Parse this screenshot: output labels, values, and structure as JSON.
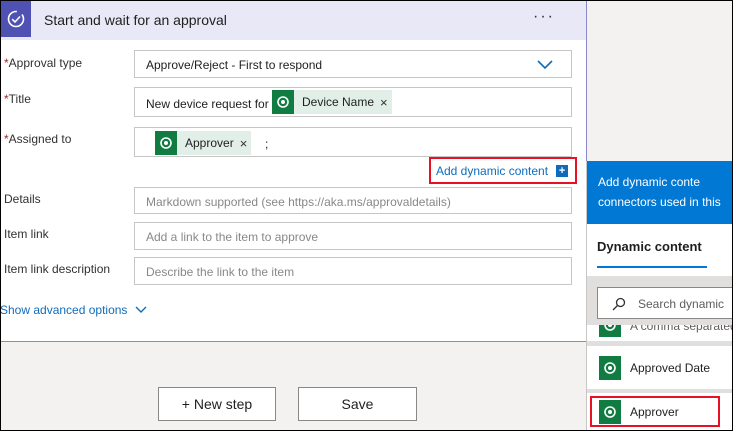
{
  "card": {
    "title": "Start and wait for an approval",
    "more_label": "···"
  },
  "fields": {
    "approval_type": {
      "required_mark": "*",
      "label": "Approval type",
      "value": "Approve/Reject - First to respond"
    },
    "title": {
      "required_mark": "*",
      "label": "Title",
      "value": "New device request for",
      "token": "Device Name"
    },
    "assigned_to": {
      "required_mark": "*",
      "label": "Assigned to",
      "token": "Approver",
      "suffix": ";"
    },
    "details": {
      "label": "Details",
      "placeholder": "Markdown supported (see https://aka.ms/approvaldetails)"
    },
    "item_link": {
      "label": "Item link",
      "placeholder": "Add a link to the item to approve"
    },
    "item_link_description": {
      "label": "Item link description",
      "placeholder": "Describe the link to the item"
    }
  },
  "add_dynamic": {
    "label": "Add dynamic content",
    "plus": "+"
  },
  "show_advanced": "Show advanced options",
  "buttons": {
    "new_step": "+ New step",
    "save": "Save"
  },
  "panel": {
    "header_line1": "Add dynamic conte",
    "header_line2": "connectors used in this",
    "tab": "Dynamic content",
    "search_placeholder": "Search dynamic",
    "partial_item": "A comma separated",
    "items": [
      "Approved Date",
      "Approver"
    ]
  },
  "colors": {
    "accent": "#0078d4",
    "card_icon": "#4f52b2",
    "token_icon": "#107c41",
    "highlight": "#e81123"
  },
  "icons": {
    "card": "approval-check-icon",
    "token": "dataverse-icon",
    "search": "search-icon",
    "chevron": "chevron-down-icon",
    "close": "close-icon"
  }
}
